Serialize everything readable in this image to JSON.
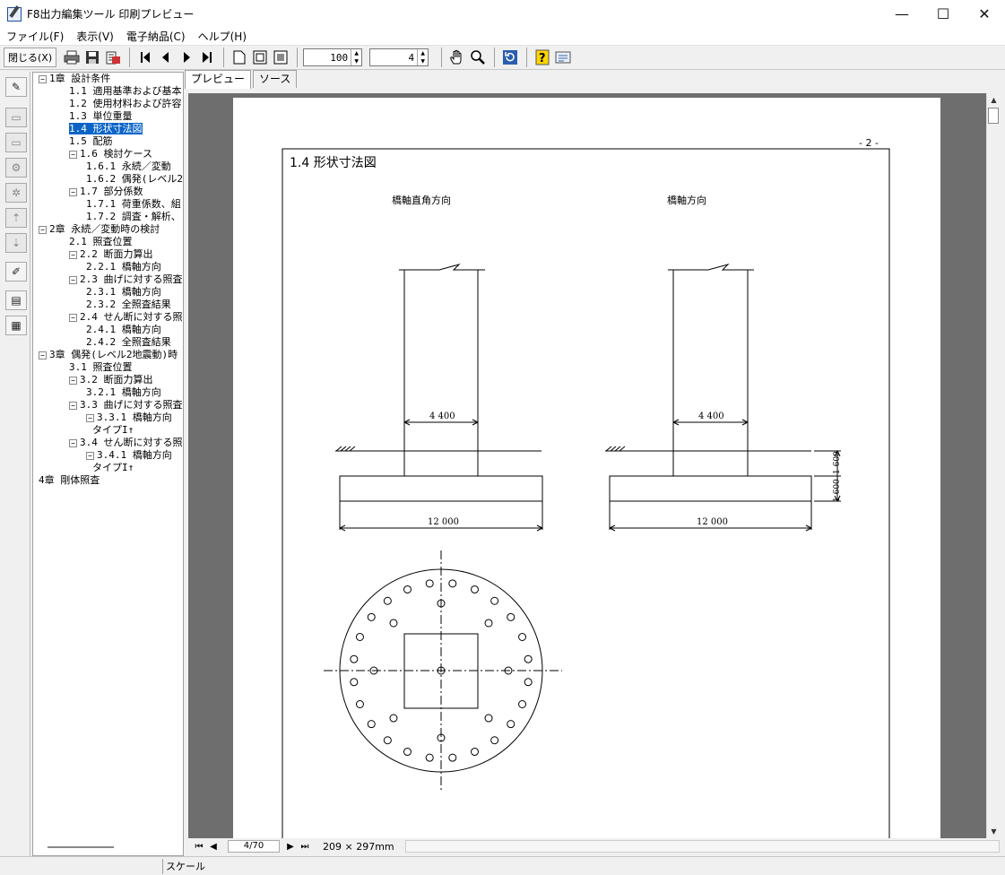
{
  "window": {
    "title": "F8出力編集ツール 印刷プレビュー",
    "minimize": "—",
    "maximize": "☐",
    "close": "✕"
  },
  "menu": [
    "ファイル(F)",
    "表示(V)",
    "電子納品(C)",
    "ヘルプ(H)"
  ],
  "toolbar": {
    "close_label": "閉じる(X)",
    "zoom_value": "100",
    "page_value": "4"
  },
  "tabs": [
    "プレビュー",
    "ソース"
  ],
  "tree": [
    {
      "depth": 0,
      "exp": "−",
      "label": "1章 設計条件"
    },
    {
      "depth": 1,
      "label": "1.1 適用基準および基本"
    },
    {
      "depth": 1,
      "label": "1.2 使用材料および許容"
    },
    {
      "depth": 1,
      "label": "1.3 単位重量"
    },
    {
      "depth": 1,
      "label": "1.4 形状寸法図",
      "selected": true
    },
    {
      "depth": 1,
      "label": "1.5 配筋"
    },
    {
      "depth": 1,
      "exp": "−",
      "label": "1.6 検討ケース"
    },
    {
      "depth": 2,
      "label": "1.6.1 永続／変動"
    },
    {
      "depth": 2,
      "label": "1.6.2 偶発(レベル2"
    },
    {
      "depth": 1,
      "exp": "−",
      "label": "1.7 部分係数"
    },
    {
      "depth": 2,
      "label": "1.7.1 荷重係数、組"
    },
    {
      "depth": 2,
      "label": "1.7.2 調査・解析、"
    },
    {
      "depth": 0,
      "exp": "−",
      "label": "2章 永続／変動時の検討"
    },
    {
      "depth": 1,
      "label": "2.1 照査位置"
    },
    {
      "depth": 1,
      "exp": "−",
      "label": "2.2 断面力算出"
    },
    {
      "depth": 2,
      "label": "2.2.1 橋軸方向"
    },
    {
      "depth": 1,
      "exp": "−",
      "label": "2.3 曲げに対する照査"
    },
    {
      "depth": 2,
      "label": "2.3.1 橋軸方向"
    },
    {
      "depth": 2,
      "label": "2.3.2 全照査結果"
    },
    {
      "depth": 1,
      "exp": "−",
      "label": "2.4 せん断に対する照査"
    },
    {
      "depth": 2,
      "label": "2.4.1 橋軸方向"
    },
    {
      "depth": 2,
      "label": "2.4.2 全照査結果"
    },
    {
      "depth": 0,
      "exp": "−",
      "label": "3章 偶発(レベル2地震動)時"
    },
    {
      "depth": 1,
      "label": "3.1 照査位置"
    },
    {
      "depth": 1,
      "exp": "−",
      "label": "3.2 断面力算出"
    },
    {
      "depth": 2,
      "label": "3.2.1 橋軸方向"
    },
    {
      "depth": 1,
      "exp": "−",
      "label": "3.3 曲げに対する照査"
    },
    {
      "depth": 2,
      "exp": "−",
      "label": "3.3.1 橋軸方向"
    },
    {
      "depth": 3,
      "label": "タイプI↑"
    },
    {
      "depth": 1,
      "exp": "−",
      "label": "3.4 せん断に対する照査"
    },
    {
      "depth": 2,
      "exp": "−",
      "label": "3.4.1 橋軸方向"
    },
    {
      "depth": 3,
      "label": "タイプI↑"
    },
    {
      "depth": 0,
      "label": "4章 剛体照査"
    }
  ],
  "page": {
    "number": "- 2 -",
    "section_title": "1.4 形状寸法図",
    "label_left": "橋軸直角方向",
    "label_right": "橋軸方向",
    "dim_col": "4 400",
    "dim_base": "12 000",
    "dim_height": "1 600",
    "dim_height2": "1 600"
  },
  "nav": {
    "page_box": "4/70",
    "paper_size": "209 × 297mm"
  },
  "status": {
    "scale_label": "スケール"
  }
}
